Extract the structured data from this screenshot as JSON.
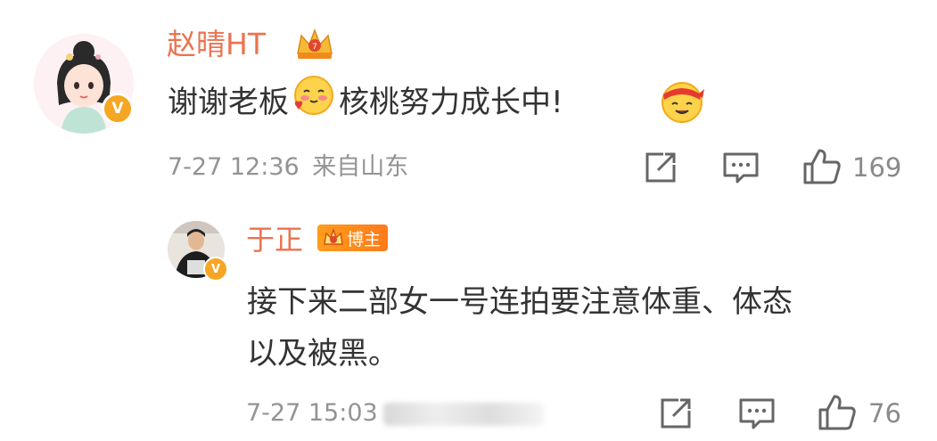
{
  "comment": {
    "username": "赵晴HT",
    "avatar_badge": "V",
    "text_part1": "谢谢老板",
    "text_part2": "核桃努力成长中!",
    "emoji1": "shy-heart-emoji",
    "emoji2": "fighting-headband-emoji",
    "time": "7-27 12:36",
    "location": "来自山东",
    "like_count": "169",
    "colors": {
      "name": "#eb7350",
      "meta": "#939393",
      "badge": "#f5a623"
    }
  },
  "reply": {
    "username": "于正",
    "avatar_badge": "V",
    "role_badge": "博主",
    "text_line1": "接下来二部女一号连拍要注意体重、体态",
    "text_line2": "以及被黑。",
    "time": "7-27 15:03",
    "like_count": "76"
  }
}
